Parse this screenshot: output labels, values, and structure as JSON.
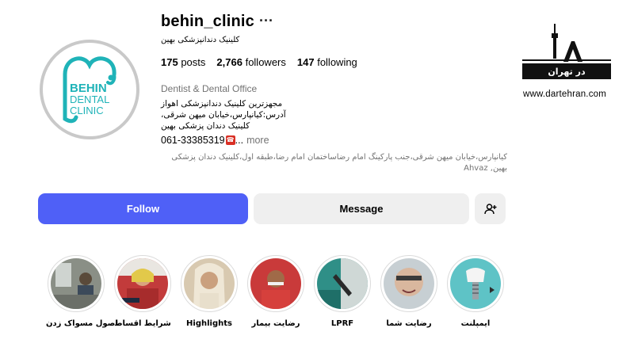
{
  "profile": {
    "username": "behin_clinic",
    "more_menu": "···",
    "full_name": "کلینیک دندانپزشکی بهین",
    "stats": {
      "posts_count": "175",
      "posts_label": "posts",
      "followers_count": "2,766",
      "followers_label": "followers",
      "following_count": "147",
      "following_label": "following"
    },
    "category": "Dentist & Dental Office",
    "bio_lines": [
      "مجهزترین کلینیک دندانپزشکی اهواز",
      "آدرس:کیانپارس،خیابان میهن شرقی،",
      "کلینیک دندان پزشکی بهین"
    ],
    "phone": "061-33385319",
    "phone_badge": "☎",
    "phone_ellipsis": "...",
    "more_label": "more",
    "address": "کیانپارس،خیابان میهن شرقی،جنب پارکینگ امام رضاساختمان امام رضا،طبقه اول،کلینیک دندان پزشکی بهین, Ahvaz",
    "avatar_logo": {
      "brand_top": "BEHIN",
      "brand_mid": "DENTAL",
      "brand_bottom": "CLINIC",
      "color": "#1fb3b8"
    }
  },
  "watermark": {
    "title": "در تهران",
    "url": "www.dartehran.com"
  },
  "actions": {
    "follow_label": "Follow",
    "message_label": "Message",
    "add_user_icon": "person-add-icon",
    "accent": "#4f60f7"
  },
  "highlights": [
    {
      "label": "اصول مسواک زدن"
    },
    {
      "label": "شرایط اقساط"
    },
    {
      "label": "Highlights"
    },
    {
      "label": "رضایت بیمار"
    },
    {
      "label": "LPRF"
    },
    {
      "label": "رضایت شما"
    },
    {
      "label": "ایمپلنت"
    }
  ]
}
